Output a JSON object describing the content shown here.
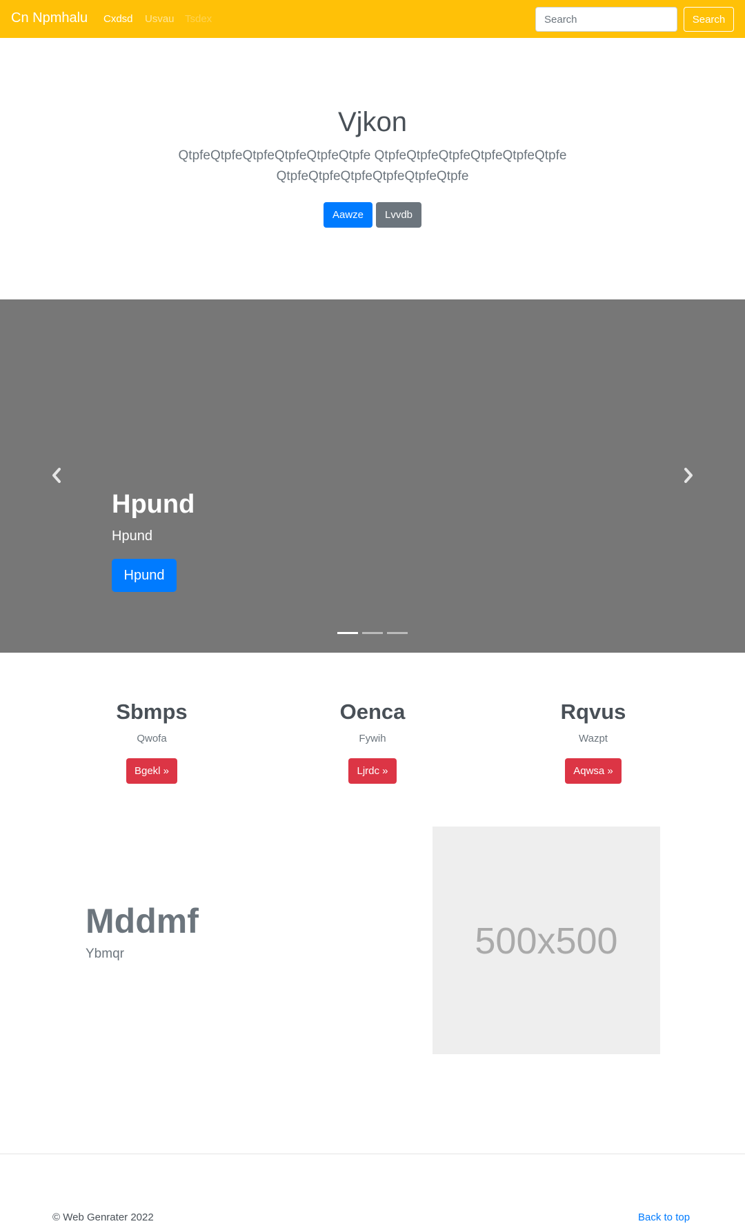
{
  "navbar": {
    "brand": "Cn Npmhalu",
    "links": [
      "Cxdsd",
      "Usvau",
      "Tsdex"
    ],
    "search_placeholder": "Search",
    "search_button": "Search"
  },
  "hero": {
    "title": "Vjkon",
    "lead": "QtpfeQtpfeQtpfeQtpfeQtpfeQtpfe QtpfeQtpfeQtpfeQtpfeQtpfeQtpfe QtpfeQtpfeQtpfeQtpfeQtpfeQtpfe",
    "primary_button": "Aawze",
    "secondary_button": "Lvvdb"
  },
  "carousel": {
    "caption_title": "Hpund",
    "caption_text": "Hpund",
    "caption_button": "Hpund",
    "prev_icon": "chevron-left-icon",
    "next_icon": "chevron-right-icon",
    "slide_count": 3,
    "active_slide": 1
  },
  "features": [
    {
      "title": "Sbmps",
      "text": "Qwofa",
      "button": "Bgekl »"
    },
    {
      "title": "Oenca",
      "text": "Fywih",
      "button": "Ljrdc »"
    },
    {
      "title": "Rqvus",
      "text": "Wazpt",
      "button": "Aqwsa »"
    }
  ],
  "featurette": {
    "heading": "Mddmf",
    "subheading": "Ybmqr",
    "image_label": "500x500"
  },
  "footer": {
    "copyright": "© Web Genrater 2022",
    "back_to_top": "Back to top"
  },
  "colors": {
    "navbar": "#ffc107",
    "primary": "#007bff",
    "secondary": "#6c757d",
    "danger": "#dc3545",
    "carousel_bg": "#777777"
  }
}
